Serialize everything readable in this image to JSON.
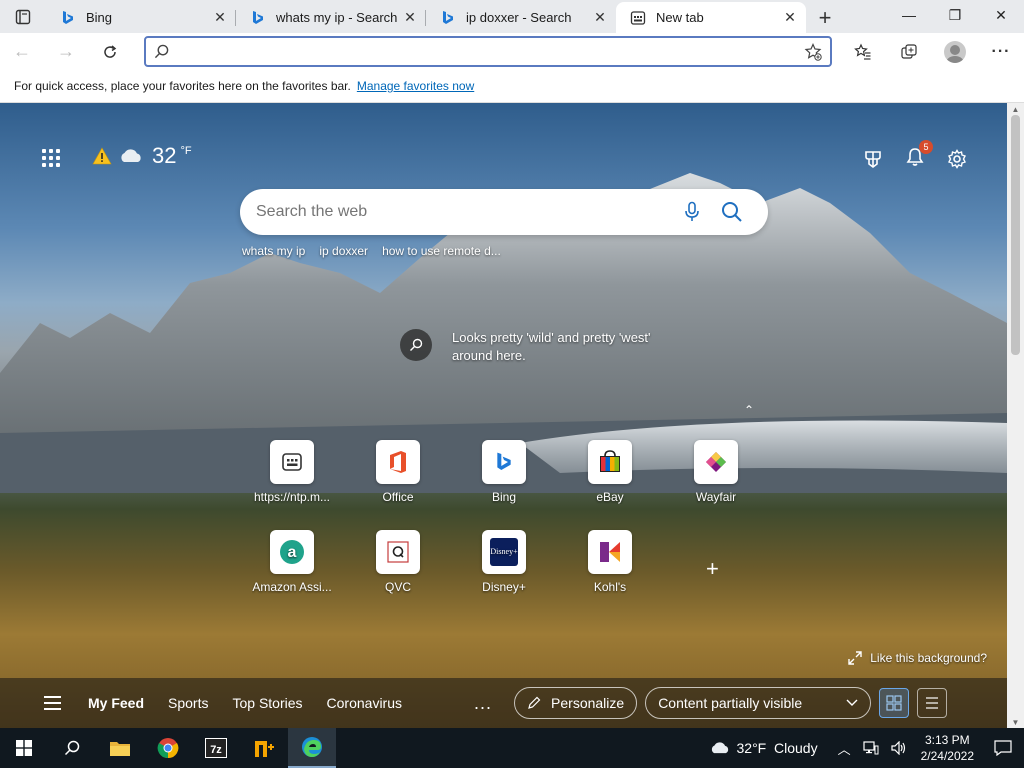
{
  "browser": {
    "tabs": [
      {
        "title": "Bing",
        "active": false
      },
      {
        "title": "whats my ip - Search",
        "active": false
      },
      {
        "title": "ip doxxer - Search",
        "active": false
      },
      {
        "title": "New tab",
        "active": true
      }
    ],
    "address": {
      "value": "",
      "placeholder": ""
    },
    "favorites_bar": {
      "text": "For quick access, place your favorites here on the favorites bar.",
      "link": "Manage favorites now"
    }
  },
  "ntp": {
    "weather": {
      "temp": "32",
      "unit": "°F"
    },
    "notifications": {
      "count": "5"
    },
    "search": {
      "placeholder": "Search the web"
    },
    "suggestions": [
      "whats my ip",
      "ip doxxer",
      "how to use remote d..."
    ],
    "image_caption": "Looks pretty 'wild' and pretty 'west' around here.",
    "tiles": [
      {
        "label": "https://ntp.m...",
        "icon": "ntp-site-icon"
      },
      {
        "label": "Office",
        "icon": "office-icon"
      },
      {
        "label": "Bing",
        "icon": "bing-icon"
      },
      {
        "label": "eBay",
        "icon": "ebay-icon"
      },
      {
        "label": "Wayfair",
        "icon": "wayfair-icon"
      },
      {
        "label": "Amazon Assi...",
        "icon": "amazon-icon"
      },
      {
        "label": "QVC",
        "icon": "qvc-icon"
      },
      {
        "label": "Disney+",
        "icon": "disney-plus-icon"
      },
      {
        "label": "Kohl's",
        "icon": "kohls-icon"
      }
    ],
    "like_background": "Like this background?",
    "feed": {
      "tabs": [
        "My Feed",
        "Sports",
        "Top Stories",
        "Coronavirus"
      ],
      "more": "...",
      "personalize": "Personalize",
      "content_visibility": "Content partially visible"
    }
  },
  "taskbar": {
    "weather": "32°F  Cloudy",
    "time": "3:13 PM",
    "date": "2/24/2022"
  },
  "colors": {
    "accent": "#0067b8",
    "badge": "#d64c2c",
    "omnibox_border": "#5a7ac0",
    "taskbar": "#10181f"
  }
}
